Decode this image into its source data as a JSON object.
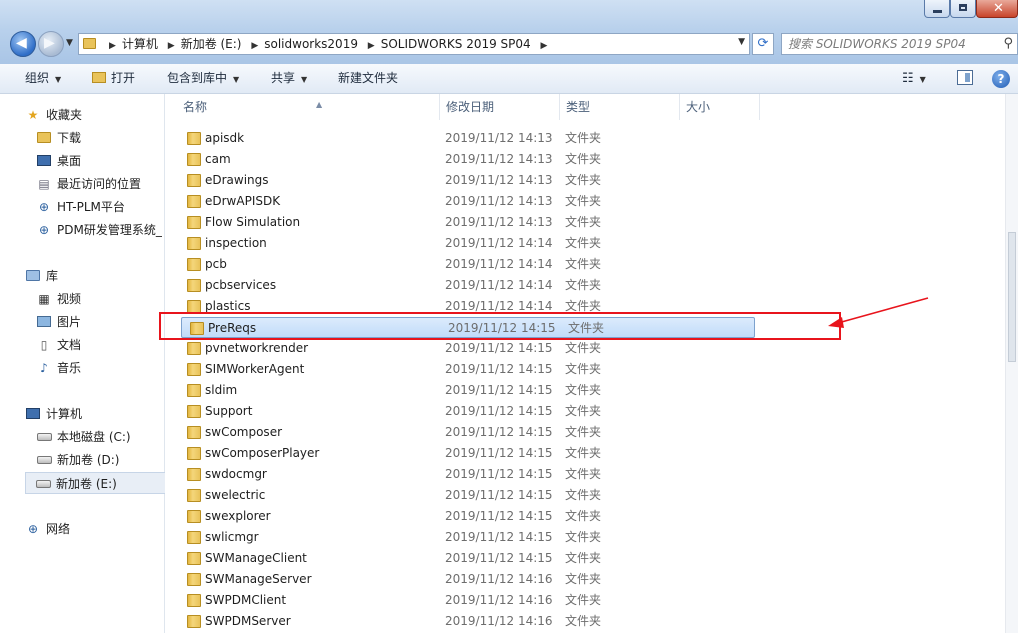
{
  "address": {
    "crumbs": [
      "计算机",
      "新加卷 (E:)",
      "solidworks2019",
      "SOLIDWORKS 2019 SP04"
    ]
  },
  "search": {
    "placeholder": "搜索 SOLIDWORKS 2019 SP04"
  },
  "toolbar": {
    "organize": "组织",
    "open": "打开",
    "include_in_library": "包含到库中",
    "share": "共享",
    "new_folder": "新建文件夹"
  },
  "navigation": {
    "favorites": "收藏夹",
    "downloads": "下载",
    "desktop": "桌面",
    "recent": "最近访问的位置",
    "ht_plm": "HT-PLM平台",
    "pdm": "PDM研发管理系统_",
    "libraries": "库",
    "videos": "视频",
    "pictures": "图片",
    "documents": "文档",
    "music": "音乐",
    "computer": "计算机",
    "drive_c": "本地磁盘 (C:)",
    "drive_d": "新加卷 (D:)",
    "drive_e": "新加卷 (E:)",
    "network": "网络"
  },
  "columns": {
    "name": "名称",
    "date": "修改日期",
    "type": "类型",
    "size": "大小"
  },
  "files": [
    {
      "name": "apisdk",
      "date": "2019/11/12 14:13",
      "type": "文件夹"
    },
    {
      "name": "cam",
      "date": "2019/11/12 14:13",
      "type": "文件夹"
    },
    {
      "name": "eDrawings",
      "date": "2019/11/12 14:13",
      "type": "文件夹"
    },
    {
      "name": "eDrwAPISDK",
      "date": "2019/11/12 14:13",
      "type": "文件夹"
    },
    {
      "name": "Flow Simulation",
      "date": "2019/11/12 14:13",
      "type": "文件夹"
    },
    {
      "name": "inspection",
      "date": "2019/11/12 14:14",
      "type": "文件夹"
    },
    {
      "name": "pcb",
      "date": "2019/11/12 14:14",
      "type": "文件夹"
    },
    {
      "name": "pcbservices",
      "date": "2019/11/12 14:14",
      "type": "文件夹"
    },
    {
      "name": "plastics",
      "date": "2019/11/12 14:14",
      "type": "文件夹"
    },
    {
      "name": "PreReqs",
      "date": "2019/11/12 14:15",
      "type": "文件夹",
      "selected": true
    },
    {
      "name": "pvnetworkrender",
      "date": "2019/11/12 14:15",
      "type": "文件夹"
    },
    {
      "name": "SIMWorkerAgent",
      "date": "2019/11/12 14:15",
      "type": "文件夹"
    },
    {
      "name": "sldim",
      "date": "2019/11/12 14:15",
      "type": "文件夹"
    },
    {
      "name": "Support",
      "date": "2019/11/12 14:15",
      "type": "文件夹"
    },
    {
      "name": "swComposer",
      "date": "2019/11/12 14:15",
      "type": "文件夹"
    },
    {
      "name": "swComposerPlayer",
      "date": "2019/11/12 14:15",
      "type": "文件夹"
    },
    {
      "name": "swdocmgr",
      "date": "2019/11/12 14:15",
      "type": "文件夹"
    },
    {
      "name": "swelectric",
      "date": "2019/11/12 14:15",
      "type": "文件夹"
    },
    {
      "name": "swexplorer",
      "date": "2019/11/12 14:15",
      "type": "文件夹"
    },
    {
      "name": "swlicmgr",
      "date": "2019/11/12 14:15",
      "type": "文件夹"
    },
    {
      "name": "SWManageClient",
      "date": "2019/11/12 14:15",
      "type": "文件夹"
    },
    {
      "name": "SWManageServer",
      "date": "2019/11/12 14:16",
      "type": "文件夹"
    },
    {
      "name": "SWPDMClient",
      "date": "2019/11/12 14:16",
      "type": "文件夹"
    },
    {
      "name": "SWPDMServer",
      "date": "2019/11/12 14:16",
      "type": "文件夹"
    }
  ],
  "colors": {
    "highlight_box": "#e8141c",
    "selection": "#c1dcfa"
  }
}
